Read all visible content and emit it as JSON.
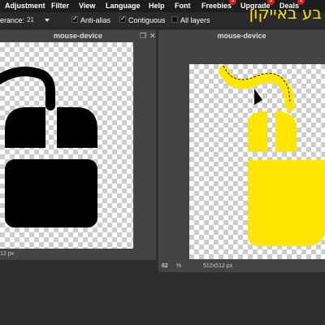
{
  "menu": {
    "items": [
      "Adjustment",
      "Filter",
      "View",
      "Language",
      "Help",
      "Font",
      "Freebies",
      "Upgrade",
      "Deals"
    ],
    "badges": {
      "freebies": "5",
      "upgrade": "1",
      "deals": "1"
    }
  },
  "options": {
    "tolerance_label": "erance:",
    "tolerance_value": "21",
    "anti_alias": {
      "label": "Anti-alias",
      "checked": true
    },
    "contiguous": {
      "label": "Contiguous",
      "checked": true
    },
    "all_layers": {
      "label": "All layers",
      "checked": false
    }
  },
  "overlay_text": "בע באייקון",
  "left_window": {
    "title": "mouse-device",
    "size_text": "12 px",
    "icon_color": "#000000"
  },
  "right_window": {
    "title": "mouse-device",
    "zoom_value": "62",
    "zoom_unit": "%",
    "size_text": "512x512 px",
    "icon_color": "#ffe600"
  },
  "colors": {
    "badge": "#e01919",
    "overlay_text": "#f2e500"
  },
  "icons": [
    "checkmark-icon",
    "restore-icon",
    "close-icon",
    "caret-down-icon",
    "mouse-icon",
    "cursor-icon"
  ]
}
